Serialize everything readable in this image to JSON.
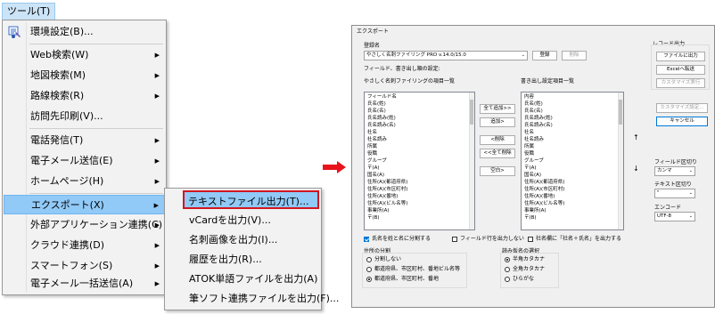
{
  "menubar": {
    "label": "ツール(T)"
  },
  "tools_menu": {
    "items": [
      {
        "label": "環境設定(B)..."
      },
      {
        "label": "Web検索(W)"
      },
      {
        "label": "地図検索(M)"
      },
      {
        "label": "路線検索(R)"
      },
      {
        "label": "訪問先印刷(V)..."
      },
      {
        "label": "電話発信(T)"
      },
      {
        "label": "電子メール送信(E)"
      },
      {
        "label": "ホームページ(H)"
      },
      {
        "label": "エクスポート(X)"
      },
      {
        "label": "外部アプリケーション連携(C)"
      },
      {
        "label": "クラウド連携(D)"
      },
      {
        "label": "スマートフォン(S)"
      },
      {
        "label": "電子メール一括送信(A)"
      }
    ]
  },
  "export_submenu": {
    "items": [
      {
        "label": "テキストファイル出力(T)..."
      },
      {
        "label": "vCardを出力(V)..."
      },
      {
        "label": "名刺画像を出力(I)..."
      },
      {
        "label": "履歴を出力(R)..."
      },
      {
        "label": "ATOK単語ファイルを出力(A)"
      },
      {
        "label": "筆ソフト連携ファイルを出力(F)..."
      }
    ]
  },
  "dialog": {
    "title": "エクスポート",
    "registration_label": "登録名",
    "registration_value": "やさしく名刺ファイリング PRO v.14.0/15.0",
    "register_button": "登録",
    "delete_button": "削除",
    "fields_setting_label": "フィールド、書き出し順の設定:",
    "left_list_label": "やさしく名刺ファイリングの項目一覧",
    "right_list_label": "書き出し設定項目一覧",
    "left_list": [
      "フィールド名",
      "氏名(姓)",
      "氏名(名)",
      "氏名読み(姓)",
      "氏名読み(名)",
      "社名",
      "社名読み",
      "所属",
      "役職",
      "グループ",
      "〒(A)",
      "国名(A)",
      "住所(A)(都道府県)",
      "住所(A)(市区町村)",
      "住所(A)(番地)",
      "住所(A)(ビル名等)",
      "事業所(A)",
      "〒(B)"
    ],
    "right_list": [
      "内容",
      "氏名(姓)",
      "氏名(名)",
      "氏名読み(姓)",
      "氏名読み(名)",
      "社名",
      "社名読み",
      "所属",
      "役職",
      "グループ",
      "〒(A)",
      "国名(A)",
      "住所(A)(都道府県)",
      "住所(A)(市区町村)",
      "住所(A)(番地)",
      "住所(A)(ビル名等)",
      "事業所(A)",
      "〒(B)"
    ],
    "add_all_button": "全て追加>>",
    "add_button": "追加>",
    "remove_button": "<削除",
    "remove_all_button": "<<全て削除",
    "blank_button": "空白>",
    "up_arrow": "↑",
    "down_arrow": "↓",
    "record_output_label": "レコード出力",
    "file_output_button": "ファイルに出力",
    "excel_transfer_button": "Excelへ転送",
    "customize_run_button": "カスタマイズ実行",
    "customize_settings_button": "カスタマイズ設定...",
    "cancel_button": "キャンセル",
    "field_delim_label": "フィールド区切り",
    "field_delim_value": "カンマ",
    "text_delim_label": "テキスト区切り",
    "text_delim_value": "\"",
    "encoding_label": "エンコード",
    "encoding_value": "UTF-8",
    "check_split_name": "氏名を姓と名に分割する",
    "check_field_row": "フィールド行を出力しない",
    "check_company_name": "社名欄に「社名＋氏名」を出力する",
    "address_split_label": "住所の分割",
    "address_opt1": "分割しない",
    "address_opt2": "都道府県、市区町村、番地ビル名等",
    "address_opt3": "都道府県、市区町村、番地",
    "reading_label": "読み仮名の選択",
    "reading_opt1": "半角カタカナ",
    "reading_opt2": "全角カタカナ",
    "reading_opt3": "ひらがな"
  },
  "colors": {
    "highlight": "#91c9f7",
    "selection_border": "#d0161f",
    "arrow": "#e8131b"
  }
}
